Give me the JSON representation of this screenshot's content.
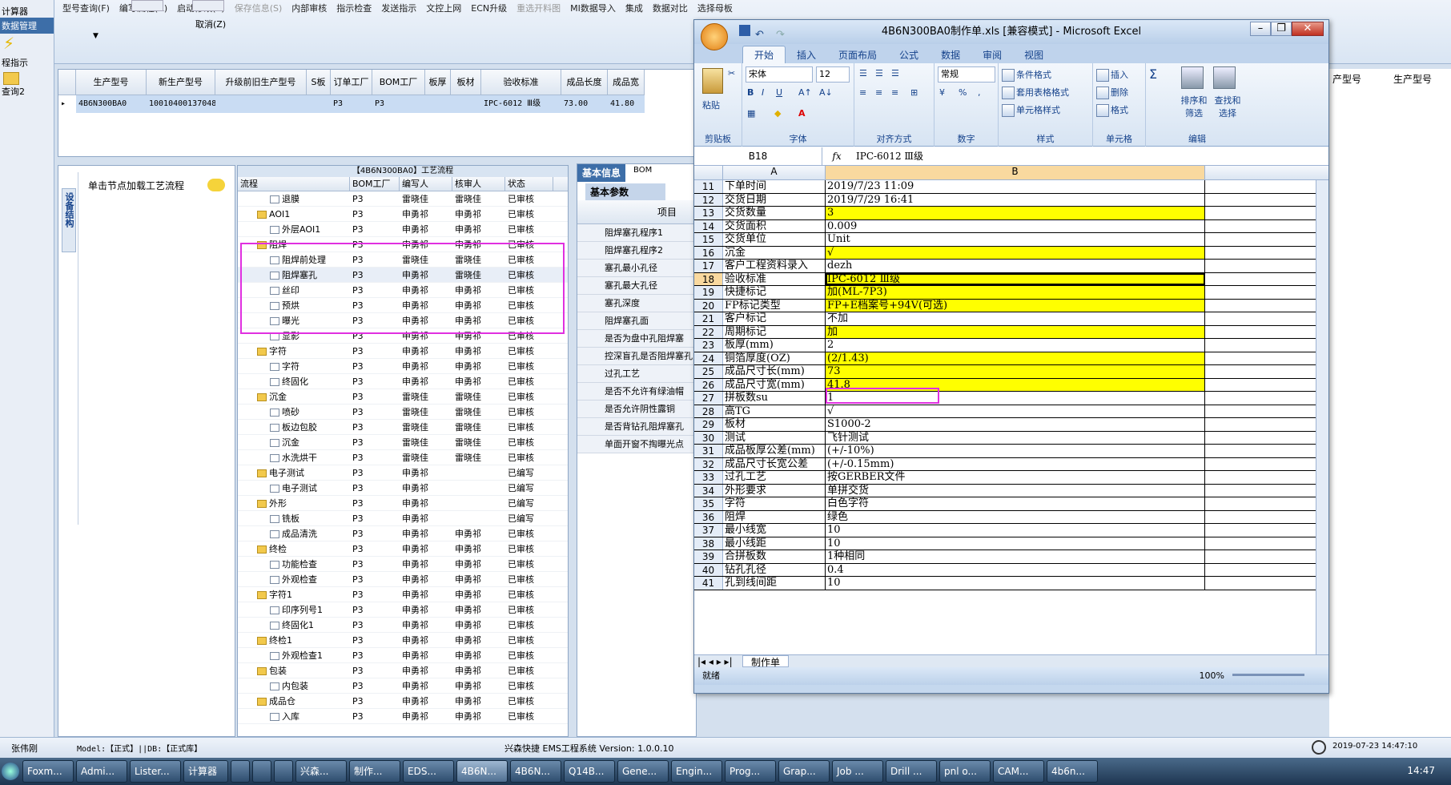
{
  "toolbar": {
    "row1": [
      "型号查询(F)",
      "编写流程(R)",
      "启动修改(E)",
      "保存信息(S)",
      "内部审核",
      "指示检查",
      "发送指示",
      "文控上网",
      "ECN升级",
      "重选开料图",
      "MI数据导入",
      "集成",
      "数据对比",
      "选择母板"
    ],
    "row2": [
      "取消(Z)"
    ]
  },
  "leftnav": {
    "items": [
      "计算器",
      "数据管理",
      "程指示",
      "查询2"
    ]
  },
  "grid1": {
    "headers": [
      "生产型号",
      "新生产型号",
      "升级前旧生产型号",
      "S板",
      "订单工厂",
      "BOM工厂",
      "板厚",
      "板材",
      "验收标准",
      "成品长度",
      "成品宽"
    ],
    "row": [
      "4B6N300BA0",
      "10010400137048",
      "",
      "",
      "P3",
      "P3",
      "",
      "",
      "IPC-6012 Ⅲ级",
      "73.00",
      "41.80"
    ],
    "right_headers": [
      "产型号",
      "生产型号"
    ]
  },
  "panel_left": {
    "side_tab": "设备结构",
    "hint": "单击节点加载工艺流程"
  },
  "tree": {
    "title": "【4B6N300BA0】工艺流程",
    "headers": [
      "流程",
      "BOM工厂",
      "编写人",
      "核审人",
      "状态"
    ],
    "rows": [
      {
        "n": "退膜",
        "l": 2,
        "f": false,
        "b": "P3",
        "w": "雷晓佳",
        "c": "雷晓佳",
        "s": "已审核"
      },
      {
        "n": "AOI1",
        "l": 1,
        "f": true,
        "b": "P3",
        "w": "申勇祁",
        "c": "申勇祁",
        "s": "已审核"
      },
      {
        "n": "外层AOI1",
        "l": 2,
        "f": false,
        "b": "P3",
        "w": "申勇祁",
        "c": "申勇祁",
        "s": "已审核"
      },
      {
        "n": "阻焊",
        "l": 1,
        "f": true,
        "b": "P3",
        "w": "申勇祁",
        "c": "申勇祁",
        "s": "已审核"
      },
      {
        "n": "阻焊前处理",
        "l": 2,
        "f": false,
        "b": "P3",
        "w": "雷晓佳",
        "c": "雷晓佳",
        "s": "已审核"
      },
      {
        "n": "阻焊塞孔",
        "l": 2,
        "f": false,
        "b": "P3",
        "w": "申勇祁",
        "c": "雷晓佳",
        "s": "已审核"
      },
      {
        "n": "丝印",
        "l": 2,
        "f": false,
        "b": "P3",
        "w": "申勇祁",
        "c": "申勇祁",
        "s": "已审核"
      },
      {
        "n": "预烘",
        "l": 2,
        "f": false,
        "b": "P3",
        "w": "申勇祁",
        "c": "申勇祁",
        "s": "已审核"
      },
      {
        "n": "曝光",
        "l": 2,
        "f": false,
        "b": "P3",
        "w": "申勇祁",
        "c": "申勇祁",
        "s": "已审核"
      },
      {
        "n": "显影",
        "l": 2,
        "f": false,
        "b": "P3",
        "w": "申勇祁",
        "c": "申勇祁",
        "s": "已审核"
      },
      {
        "n": "字符",
        "l": 1,
        "f": true,
        "b": "P3",
        "w": "申勇祁",
        "c": "申勇祁",
        "s": "已审核"
      },
      {
        "n": "字符",
        "l": 2,
        "f": false,
        "b": "P3",
        "w": "申勇祁",
        "c": "申勇祁",
        "s": "已审核"
      },
      {
        "n": "终固化",
        "l": 2,
        "f": false,
        "b": "P3",
        "w": "申勇祁",
        "c": "申勇祁",
        "s": "已审核"
      },
      {
        "n": "沉金",
        "l": 1,
        "f": true,
        "b": "P3",
        "w": "雷晓佳",
        "c": "雷晓佳",
        "s": "已审核"
      },
      {
        "n": "喷砂",
        "l": 2,
        "f": false,
        "b": "P3",
        "w": "雷晓佳",
        "c": "雷晓佳",
        "s": "已审核"
      },
      {
        "n": "板边包胶",
        "l": 2,
        "f": false,
        "b": "P3",
        "w": "雷晓佳",
        "c": "雷晓佳",
        "s": "已审核"
      },
      {
        "n": "沉金",
        "l": 2,
        "f": false,
        "b": "P3",
        "w": "雷晓佳",
        "c": "雷晓佳",
        "s": "已审核"
      },
      {
        "n": "水洗烘干",
        "l": 2,
        "f": false,
        "b": "P3",
        "w": "雷晓佳",
        "c": "雷晓佳",
        "s": "已审核"
      },
      {
        "n": "电子测试",
        "l": 1,
        "f": true,
        "b": "P3",
        "w": "申勇祁",
        "c": "",
        "s": "已编写"
      },
      {
        "n": "电子测试",
        "l": 2,
        "f": false,
        "b": "P3",
        "w": "申勇祁",
        "c": "",
        "s": "已编写"
      },
      {
        "n": "外形",
        "l": 1,
        "f": true,
        "b": "P3",
        "w": "申勇祁",
        "c": "",
        "s": "已编写"
      },
      {
        "n": "铣板",
        "l": 2,
        "f": false,
        "b": "P3",
        "w": "申勇祁",
        "c": "",
        "s": "已编写"
      },
      {
        "n": "成品清洗",
        "l": 2,
        "f": false,
        "b": "P3",
        "w": "申勇祁",
        "c": "申勇祁",
        "s": "已审核"
      },
      {
        "n": "终检",
        "l": 1,
        "f": true,
        "b": "P3",
        "w": "申勇祁",
        "c": "申勇祁",
        "s": "已审核"
      },
      {
        "n": "功能检查",
        "l": 2,
        "f": false,
        "b": "P3",
        "w": "申勇祁",
        "c": "申勇祁",
        "s": "已审核"
      },
      {
        "n": "外观检查",
        "l": 2,
        "f": false,
        "b": "P3",
        "w": "申勇祁",
        "c": "申勇祁",
        "s": "已审核"
      },
      {
        "n": "字符1",
        "l": 1,
        "f": true,
        "b": "P3",
        "w": "申勇祁",
        "c": "申勇祁",
        "s": "已审核"
      },
      {
        "n": "印序列号1",
        "l": 2,
        "f": false,
        "b": "P3",
        "w": "申勇祁",
        "c": "申勇祁",
        "s": "已审核"
      },
      {
        "n": "终固化1",
        "l": 2,
        "f": false,
        "b": "P3",
        "w": "申勇祁",
        "c": "申勇祁",
        "s": "已审核"
      },
      {
        "n": "终检1",
        "l": 1,
        "f": true,
        "b": "P3",
        "w": "申勇祁",
        "c": "申勇祁",
        "s": "已审核"
      },
      {
        "n": "外观检查1",
        "l": 2,
        "f": false,
        "b": "P3",
        "w": "申勇祁",
        "c": "申勇祁",
        "s": "已审核"
      },
      {
        "n": "包装",
        "l": 1,
        "f": true,
        "b": "P3",
        "w": "申勇祁",
        "c": "申勇祁",
        "s": "已审核"
      },
      {
        "n": "内包装",
        "l": 2,
        "f": false,
        "b": "P3",
        "w": "申勇祁",
        "c": "申勇祁",
        "s": "已审核"
      },
      {
        "n": "成品仓",
        "l": 1,
        "f": true,
        "b": "P3",
        "w": "申勇祁",
        "c": "申勇祁",
        "s": "已审核"
      },
      {
        "n": "入库",
        "l": 2,
        "f": false,
        "b": "P3",
        "w": "申勇祁",
        "c": "申勇祁",
        "s": "已审核"
      }
    ]
  },
  "mid": {
    "tabs": [
      "基本信息",
      "BOM"
    ],
    "subtab": "基本参数",
    "col": "项目",
    "rows": [
      "阻焊塞孔程序1",
      "阻焊塞孔程序2",
      "塞孔最小孔径",
      "塞孔最大孔径",
      "塞孔深度",
      "阻焊塞孔面",
      "是否为盘中孔阻焊塞",
      "控深盲孔是否阻焊塞孔",
      "过孔工艺",
      "是否不允许有绿油帽",
      "是否允许阴性露铜",
      "是否背钻孔阻焊塞孔",
      "单面开窗不掏曝光点"
    ]
  },
  "excel": {
    "title": "4B6N300BA0制作单.xls [兼容模式] - Microsoft Excel",
    "tabs": [
      "开始",
      "插入",
      "页面布局",
      "公式",
      "数据",
      "审阅",
      "视图"
    ],
    "font_name": "宋体",
    "font_size": "12",
    "num_format": "常规",
    "groups": [
      "剪贴板",
      "字体",
      "对齐方式",
      "数字",
      "样式",
      "单元格",
      "编辑"
    ],
    "style_btns": [
      "条件格式",
      "套用表格格式",
      "单元格样式"
    ],
    "cell_btns": [
      "插入",
      "删除",
      "格式"
    ],
    "edit_btns": [
      "排序和筛选",
      "查找和选择"
    ],
    "paste": "粘贴",
    "namebox": "B18",
    "formula": "IPC-6012 Ⅲ级",
    "col_a": "A",
    "col_b": "B",
    "rows": [
      {
        "r": "11",
        "a": "下单时间",
        "b": "2019/7/23 11:09",
        "y": false
      },
      {
        "r": "12",
        "a": "交货日期",
        "b": "2019/7/29 16:41",
        "y": false
      },
      {
        "r": "13",
        "a": "交货数量",
        "b": "3",
        "y": true
      },
      {
        "r": "14",
        "a": "交货面积",
        "b": "0.009",
        "y": false
      },
      {
        "r": "15",
        "a": "交货单位",
        "b": "Unit",
        "y": false
      },
      {
        "r": "16",
        "a": "沉金",
        "b": "√",
        "y": true
      },
      {
        "r": "17",
        "a": "客户工程资料录入",
        "b": "dezh",
        "y": false
      },
      {
        "r": "18",
        "a": "验收标准",
        "b": "IPC-6012 Ⅲ级",
        "y": true
      },
      {
        "r": "19",
        "a": "快捷标记",
        "b": "加(ML-7P3)",
        "y": true
      },
      {
        "r": "20",
        "a": "FP标记类型",
        "b": "FP+E档案号+94V(可选)",
        "y": true
      },
      {
        "r": "21",
        "a": "客户标记",
        "b": "不加",
        "y": false
      },
      {
        "r": "22",
        "a": "周期标记",
        "b": "加",
        "y": true
      },
      {
        "r": "23",
        "a": "板厚(mm)",
        "b": "2",
        "y": false
      },
      {
        "r": "24",
        "a": "铜箔厚度(OZ)",
        "b": "(2/1.43)",
        "y": true
      },
      {
        "r": "25",
        "a": "成品尺寸长(mm)",
        "b": "73",
        "y": true
      },
      {
        "r": "26",
        "a": "成品尺寸宽(mm)",
        "b": "41.8",
        "y": true
      },
      {
        "r": "27",
        "a": "拼板数su",
        "b": "1",
        "y": false
      },
      {
        "r": "28",
        "a": "高TG",
        "b": "√",
        "y": false
      },
      {
        "r": "29",
        "a": "板材",
        "b": "S1000-2",
        "y": false
      },
      {
        "r": "30",
        "a": "测试",
        "b": "飞针测试",
        "y": false
      },
      {
        "r": "31",
        "a": "成品板厚公差(mm)",
        "b": "(+/-10%)",
        "y": false
      },
      {
        "r": "32",
        "a": "成品尺寸长宽公差",
        "b": "(+/-0.15mm)",
        "y": false
      },
      {
        "r": "33",
        "a": "过孔工艺",
        "b": "按GERBER文件",
        "y": false
      },
      {
        "r": "34",
        "a": "外形要求",
        "b": "单拼交货",
        "y": false
      },
      {
        "r": "35",
        "a": "字符",
        "b": "白色字符",
        "y": false
      },
      {
        "r": "36",
        "a": "阻焊",
        "b": "绿色",
        "y": false
      },
      {
        "r": "37",
        "a": "最小线宽",
        "b": "10",
        "y": false
      },
      {
        "r": "38",
        "a": "最小线距",
        "b": "10",
        "y": false
      },
      {
        "r": "39",
        "a": "合拼板数",
        "b": "1种相同",
        "y": false
      },
      {
        "r": "40",
        "a": "钻孔孔径",
        "b": "0.4",
        "y": false
      },
      {
        "r": "41",
        "a": "孔到线间距",
        "b": "10",
        "y": false
      }
    ],
    "sheet_tab": "制作单",
    "status": "就绪",
    "zoom": "100%"
  },
  "status": {
    "user": "张伟刚",
    "model": "Model:【正式】||DB:【正式库】",
    "app": "兴森快捷 EMS工程系统 Version: 1.0.0.10",
    "datetime": "2019-07-23 14:47:10"
  },
  "taskbar": {
    "items": [
      "Foxm...",
      "Admi...",
      "Lister...",
      "计算器",
      "",
      "",
      "",
      "兴森...",
      "制作...",
      "EDS...",
      "4B6N...",
      "4B6N...",
      "Q14B...",
      "Gene...",
      "Engin...",
      "Prog...",
      "Grap...",
      "Job ...",
      "Drill ...",
      "pnl o...",
      "CAM...",
      "4b6n..."
    ],
    "clock": "14:47"
  }
}
